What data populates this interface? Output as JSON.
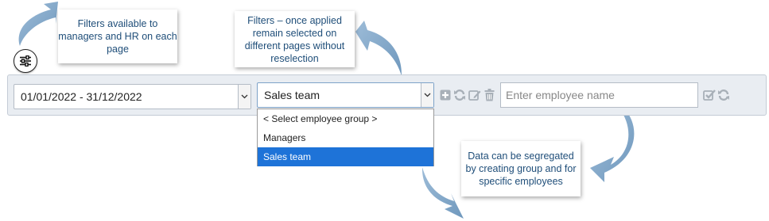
{
  "callouts": {
    "managers_hr": "Filters available to managers and HR on each page",
    "filters_persist": "Filters – once applied remain selected on different pages without reselection",
    "segregation": "Data can be segregated by creating group and for specific employees"
  },
  "filters": {
    "date_range": "01/01/2022 - 31/12/2022",
    "employee_group": {
      "selected": "Sales team",
      "options": [
        "< Select employee group >",
        "Managers",
        "Sales team"
      ]
    },
    "employee_name": {
      "value": "",
      "placeholder": "Enter employee name"
    }
  },
  "icons": {
    "filter_toggle": "sliders-icon",
    "group_actions": [
      "add-icon",
      "refresh-icon",
      "edit-icon",
      "delete-icon"
    ],
    "name_actions": [
      "apply-icon",
      "refresh-icon"
    ]
  },
  "colors": {
    "callout_text": "#1f4e79",
    "arrow": "#7ea6c9",
    "selected_option": "#1e73d8",
    "bar_background": "#e9edf2",
    "action_icon": "#a8b0b8"
  }
}
